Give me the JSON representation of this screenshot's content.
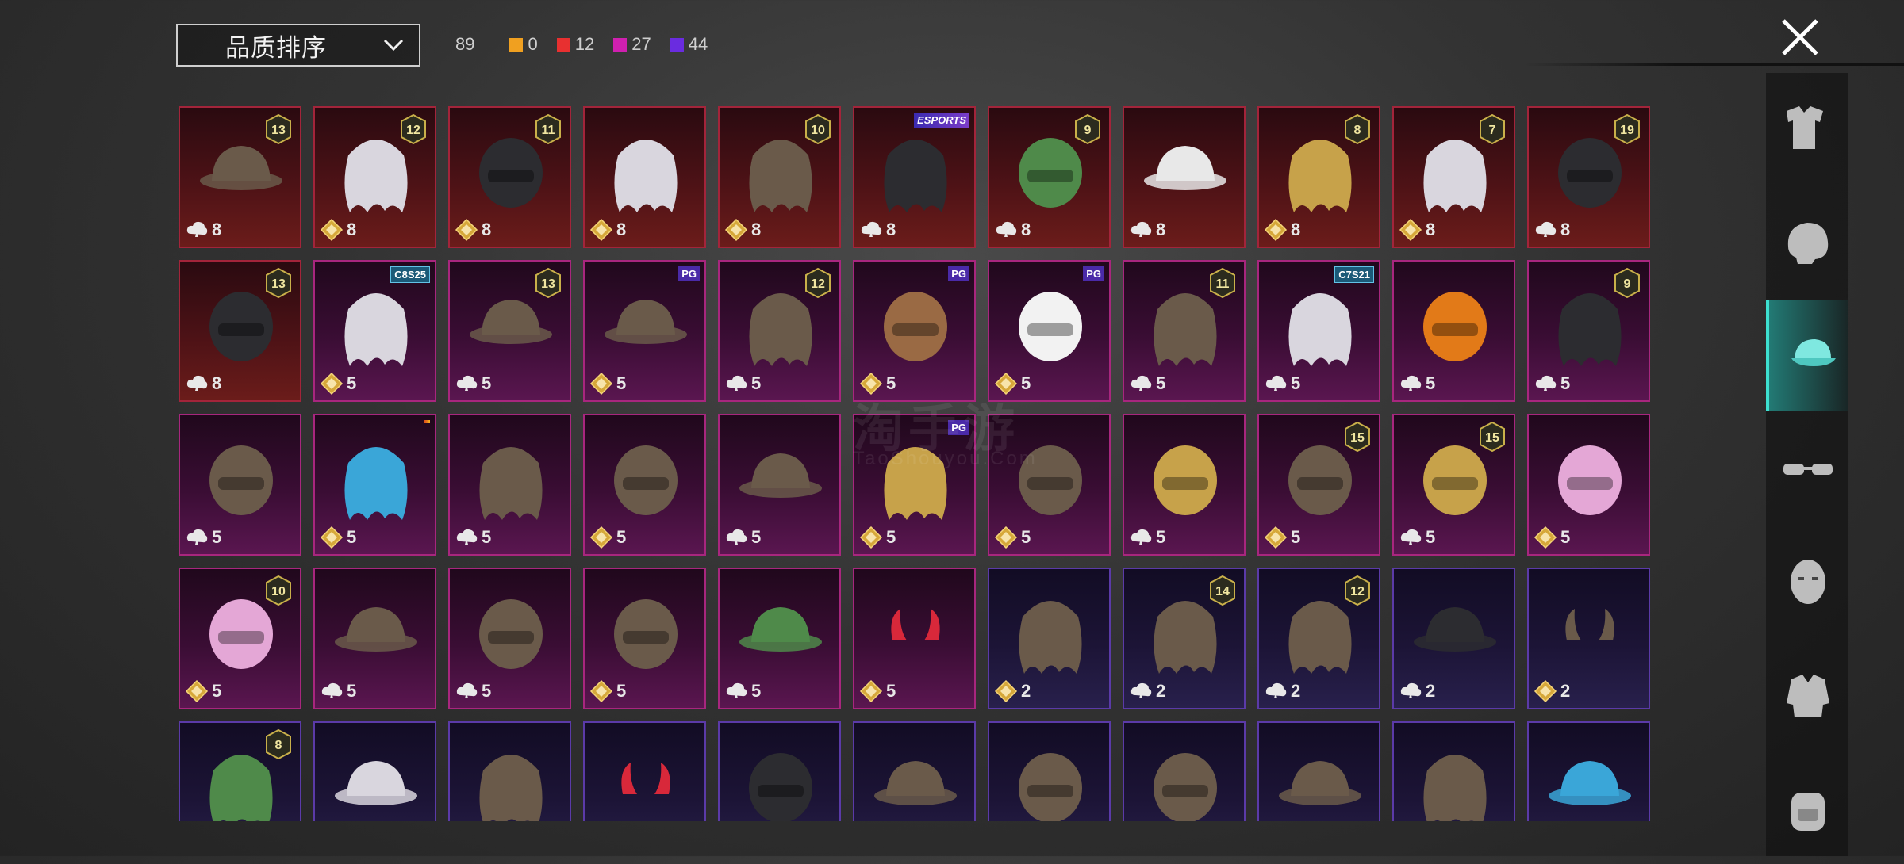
{
  "header": {
    "sort_label": "品质排序",
    "total": "89",
    "counts": [
      {
        "color": "#f0a020",
        "value": "0"
      },
      {
        "color": "#e83030",
        "value": "12"
      },
      {
        "color": "#d020b0",
        "value": "27"
      },
      {
        "color": "#6a2ce0",
        "value": "44"
      }
    ],
    "close_icon": "close-icon"
  },
  "watermark": {
    "text": "淘手游",
    "sub": "TaoShouyou.Com"
  },
  "items": [
    {
      "tier": "red",
      "stars": "8",
      "star": "cloud",
      "lvl": "13",
      "icon": "hat-feather"
    },
    {
      "tier": "red",
      "stars": "8",
      "star": "gold",
      "lvl": "12",
      "icon": "hair-white"
    },
    {
      "tier": "red",
      "stars": "8",
      "star": "gold",
      "lvl": "11",
      "icon": "helmet-dark"
    },
    {
      "tier": "red",
      "stars": "8",
      "star": "gold",
      "lvl": "",
      "icon": "hair-ghost"
    },
    {
      "tier": "red",
      "stars": "8",
      "star": "gold",
      "lvl": "10",
      "icon": "hair-brown"
    },
    {
      "tier": "red",
      "stars": "8",
      "star": "cloud",
      "lvl": "",
      "tag": "ESPORTS",
      "icon": "hair-dark"
    },
    {
      "tier": "red",
      "stars": "8",
      "star": "cloud",
      "lvl": "9",
      "icon": "head-zombie"
    },
    {
      "tier": "red",
      "stars": "8",
      "star": "cloud",
      "lvl": "",
      "icon": "cowboy-hat"
    },
    {
      "tier": "red",
      "stars": "8",
      "star": "gold",
      "lvl": "8",
      "icon": "hair-blonde"
    },
    {
      "tier": "red",
      "stars": "8",
      "star": "gold",
      "lvl": "7",
      "icon": "hair-silver"
    },
    {
      "tier": "red",
      "stars": "8",
      "star": "cloud",
      "lvl": "19",
      "icon": "helmet-moto"
    },
    {
      "tier": "red",
      "stars": "8",
      "star": "cloud",
      "lvl": "13",
      "icon": "gas-mask"
    },
    {
      "tier": "pink",
      "stars": "5",
      "star": "gold",
      "lvl": "",
      "tag": "C8S25",
      "icon": "hair-gray"
    },
    {
      "tier": "pink",
      "stars": "5",
      "star": "cloud",
      "lvl": "13",
      "icon": "aviator-cap"
    },
    {
      "tier": "pink",
      "stars": "5",
      "star": "gold",
      "lvl": "",
      "tag": "PG",
      "icon": "cap-goggles"
    },
    {
      "tier": "pink",
      "stars": "5",
      "star": "cloud",
      "lvl": "12",
      "icon": "hair-braids"
    },
    {
      "tier": "pink",
      "stars": "5",
      "star": "gold",
      "lvl": "",
      "tag": "PG",
      "icon": "bull-mask"
    },
    {
      "tier": "pink",
      "stars": "5",
      "star": "gold",
      "lvl": "",
      "tag": "PG",
      "icon": "panda-mask"
    },
    {
      "tier": "pink",
      "stars": "5",
      "star": "cloud",
      "lvl": "11",
      "icon": "hair-flower"
    },
    {
      "tier": "pink",
      "stars": "5",
      "star": "cloud",
      "lvl": "",
      "tag": "C7S21",
      "icon": "hair-wave"
    },
    {
      "tier": "pink",
      "stars": "5",
      "star": "cloud",
      "lvl": "",
      "icon": "pumpkin"
    },
    {
      "tier": "pink",
      "stars": "5",
      "star": "cloud",
      "lvl": "9",
      "icon": "hair-long-dark"
    },
    {
      "tier": "pink",
      "stars": "5",
      "star": "cloud",
      "lvl": "",
      "icon": "helmet-visor"
    },
    {
      "tier": "pink",
      "stars": "5",
      "star": "gold",
      "lvl": "",
      "tag": "DRAGON",
      "icon": "hair-blue"
    },
    {
      "tier": "pink",
      "stars": "5",
      "star": "cloud",
      "lvl": "",
      "icon": "hair-dreads"
    },
    {
      "tier": "pink",
      "stars": "5",
      "star": "gold",
      "lvl": "",
      "icon": "bird-helmet"
    },
    {
      "tier": "pink",
      "stars": "5",
      "star": "cloud",
      "lvl": "",
      "icon": "wide-hat"
    },
    {
      "tier": "pink",
      "stars": "5",
      "star": "gold",
      "lvl": "",
      "tag": "PG",
      "icon": "hair-gold"
    },
    {
      "tier": "pink",
      "stars": "5",
      "star": "gold",
      "lvl": "",
      "icon": "dragon-helm"
    },
    {
      "tier": "pink",
      "stars": "5",
      "star": "cloud",
      "lvl": "",
      "icon": "gold-helm"
    },
    {
      "tier": "pink",
      "stars": "5",
      "star": "gold",
      "lvl": "15",
      "icon": "spike-helm"
    },
    {
      "tier": "pink",
      "stars": "5",
      "star": "cloud",
      "lvl": "15",
      "icon": "gold-helmet-2"
    },
    {
      "tier": "pink",
      "stars": "5",
      "star": "gold",
      "lvl": "",
      "icon": "pink-mask"
    },
    {
      "tier": "pink",
      "stars": "5",
      "star": "gold",
      "lvl": "10",
      "icon": "pink-helmet"
    },
    {
      "tier": "pink",
      "stars": "5",
      "star": "cloud",
      "lvl": "",
      "icon": "antler-hat"
    },
    {
      "tier": "pink",
      "stars": "5",
      "star": "cloud",
      "lvl": "",
      "icon": "tv-head"
    },
    {
      "tier": "pink",
      "stars": "5",
      "star": "gold",
      "lvl": "",
      "icon": "space-helmet"
    },
    {
      "tier": "pink",
      "stars": "5",
      "star": "cloud",
      "lvl": "",
      "icon": "frog-hat"
    },
    {
      "tier": "pink",
      "stars": "5",
      "star": "gold",
      "lvl": "",
      "icon": "devil-horns"
    },
    {
      "tier": "violet",
      "stars": "2",
      "star": "gold",
      "lvl": "",
      "icon": "goggles-hair"
    },
    {
      "tier": "violet",
      "stars": "2",
      "star": "cloud",
      "lvl": "14",
      "icon": "cat-hair"
    },
    {
      "tier": "violet",
      "stars": "2",
      "star": "cloud",
      "lvl": "12",
      "icon": "bunny-ears"
    },
    {
      "tier": "violet",
      "stars": "2",
      "star": "cloud",
      "lvl": "",
      "icon": "black-cap"
    },
    {
      "tier": "violet",
      "stars": "2",
      "star": "gold",
      "lvl": "",
      "icon": "horns-purple"
    },
    {
      "tier": "violet",
      "stars": "",
      "star": "",
      "lvl": "8",
      "icon": "alien-hood"
    },
    {
      "tier": "violet",
      "stars": "",
      "star": "",
      "lvl": "",
      "icon": "cap-white"
    },
    {
      "tier": "violet",
      "stars": "",
      "star": "",
      "lvl": "",
      "icon": "aviator-brown"
    },
    {
      "tier": "violet",
      "stars": "",
      "star": "",
      "lvl": "",
      "icon": "fox-ears"
    },
    {
      "tier": "violet",
      "stars": "",
      "star": "",
      "lvl": "",
      "icon": "black-helmet"
    },
    {
      "tier": "violet",
      "stars": "",
      "star": "",
      "lvl": "",
      "icon": "witch-hat"
    },
    {
      "tier": "violet",
      "stars": "",
      "star": "",
      "lvl": "",
      "icon": "football-helmet"
    },
    {
      "tier": "violet",
      "stars": "",
      "star": "",
      "lvl": "",
      "icon": "cricket-helmet"
    },
    {
      "tier": "violet",
      "stars": "",
      "star": "",
      "lvl": "",
      "icon": "steampunk-hat"
    },
    {
      "tier": "violet",
      "stars": "",
      "star": "",
      "lvl": "",
      "icon": "hair-bun"
    },
    {
      "tier": "violet",
      "stars": "",
      "star": "",
      "lvl": "",
      "icon": "cap-blue"
    }
  ],
  "sidenav": [
    {
      "name": "nav-outfit",
      "icon": "outfit-icon",
      "active": false
    },
    {
      "name": "nav-head",
      "icon": "head-icon",
      "active": false
    },
    {
      "name": "nav-hat",
      "icon": "cap-icon",
      "active": true
    },
    {
      "name": "nav-glasses",
      "icon": "glasses-icon",
      "active": false
    },
    {
      "name": "nav-face",
      "icon": "face-icon",
      "active": false
    },
    {
      "name": "nav-jacket",
      "icon": "jacket-icon",
      "active": false
    },
    {
      "name": "nav-backpack",
      "icon": "backpack-icon",
      "active": false
    }
  ]
}
